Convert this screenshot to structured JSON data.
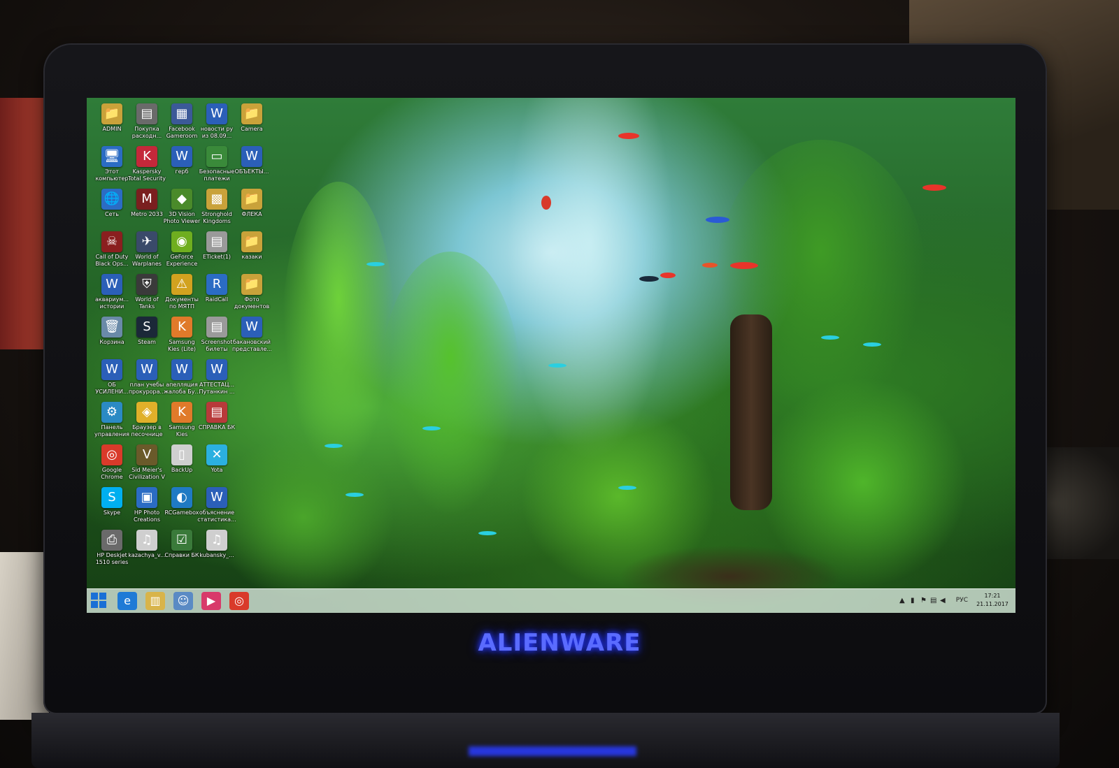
{
  "brand": {
    "logo_text": "ALIENWARE"
  },
  "desktop": {
    "icons": [
      {
        "label": "ADMIN",
        "glyph": "📁",
        "color": "#c9a23a",
        "col": 0,
        "row": 0
      },
      {
        "label": "Покупка расходн...",
        "glyph": "▤",
        "color": "#6a6a6a",
        "col": 1,
        "row": 0
      },
      {
        "label": "Facebook Gameroom",
        "glyph": "▦",
        "color": "#3b5998",
        "col": 2,
        "row": 0
      },
      {
        "label": "новости ру из 08.09...",
        "glyph": "W",
        "color": "#2b5fb8",
        "col": 3,
        "row": 0
      },
      {
        "label": "Camera",
        "glyph": "📁",
        "color": "#c9a23a",
        "col": 4,
        "row": 0
      },
      {
        "label": "Этот компьютер",
        "glyph": "🖥",
        "color": "#2b6cc4",
        "col": 0,
        "row": 1
      },
      {
        "label": "Kaspersky Total Security",
        "glyph": "K",
        "color": "#c4283a",
        "col": 1,
        "row": 1
      },
      {
        "label": "герб",
        "glyph": "W",
        "color": "#2b5fb8",
        "col": 2,
        "row": 1
      },
      {
        "label": "Безопасные платежи",
        "glyph": "▭",
        "color": "#3a8a3a",
        "col": 3,
        "row": 1
      },
      {
        "label": "ОБЪЕКТЫ...",
        "glyph": "W",
        "color": "#2b5fb8",
        "col": 4,
        "row": 1
      },
      {
        "label": "Сеть",
        "glyph": "🌐",
        "color": "#2b6cc4",
        "col": 0,
        "row": 2
      },
      {
        "label": "Metro 2033",
        "glyph": "M",
        "color": "#7a1f1f",
        "col": 1,
        "row": 2
      },
      {
        "label": "3D Vision Photo Viewer",
        "glyph": "◆",
        "color": "#4a8a2a",
        "col": 2,
        "row": 2
      },
      {
        "label": "Stronghold Kingdoms",
        "glyph": "▩",
        "color": "#c9a23a",
        "col": 3,
        "row": 2
      },
      {
        "label": "ФЛЕКА",
        "glyph": "📁",
        "color": "#c9a23a",
        "col": 4,
        "row": 2
      },
      {
        "label": "Call of Duty Black Ops...",
        "glyph": "☠",
        "color": "#8a1f1f",
        "col": 0,
        "row": 3
      },
      {
        "label": "World of Warplanes",
        "glyph": "✈",
        "color": "#3a4a6a",
        "col": 1,
        "row": 3
      },
      {
        "label": "GeForce Experience",
        "glyph": "◉",
        "color": "#6fae1f",
        "col": 2,
        "row": 3
      },
      {
        "label": "ETicket(1)",
        "glyph": "▤",
        "color": "#9a9a9a",
        "col": 3,
        "row": 3
      },
      {
        "label": "казаки",
        "glyph": "📁",
        "color": "#c9a23a",
        "col": 4,
        "row": 3
      },
      {
        "label": "аквариум... истории",
        "glyph": "W",
        "color": "#2b5fb8",
        "col": 0,
        "row": 4
      },
      {
        "label": "World of Tanks",
        "glyph": "⛨",
        "color": "#3a3a3a",
        "col": 1,
        "row": 4
      },
      {
        "label": "Документы по МЯТП",
        "glyph": "⚠",
        "color": "#d2a21f",
        "col": 2,
        "row": 4
      },
      {
        "label": "RaidCall",
        "glyph": "R",
        "color": "#2b6cc4",
        "col": 3,
        "row": 4
      },
      {
        "label": "Фото документов",
        "glyph": "📁",
        "color": "#c9a23a",
        "col": 4,
        "row": 4
      },
      {
        "label": "Корзина",
        "glyph": "🗑",
        "color": "#6a8aa8",
        "col": 0,
        "row": 5
      },
      {
        "label": "Steam",
        "glyph": "S",
        "color": "#1b2838",
        "col": 1,
        "row": 5
      },
      {
        "label": "Samsung Kies (Lite)",
        "glyph": "K",
        "color": "#e07a2a",
        "col": 2,
        "row": 5
      },
      {
        "label": "Screenshot билеты",
        "glyph": "▤",
        "color": "#9a9a9a",
        "col": 3,
        "row": 5
      },
      {
        "label": "бакановский представле...",
        "glyph": "W",
        "color": "#2b5fb8",
        "col": 4,
        "row": 5
      },
      {
        "label": "ОБ УСИЛЕНИ...",
        "glyph": "W",
        "color": "#2b5fb8",
        "col": 0,
        "row": 6
      },
      {
        "label": "план учебы прокурора...",
        "glyph": "W",
        "color": "#2b5fb8",
        "col": 1,
        "row": 6
      },
      {
        "label": "апелляция жалоба Бу...",
        "glyph": "W",
        "color": "#2b5fb8",
        "col": 2,
        "row": 6
      },
      {
        "label": "АТТЕСТАЦ... Путанкин ...",
        "glyph": "W",
        "color": "#2b5fb8",
        "col": 3,
        "row": 6
      },
      {
        "label": "Панель управления",
        "glyph": "⚙",
        "color": "#2b8ac4",
        "col": 0,
        "row": 7
      },
      {
        "label": "Браузер в песочнице",
        "glyph": "◈",
        "color": "#e0b02a",
        "col": 1,
        "row": 7
      },
      {
        "label": "Samsung Kies",
        "glyph": "K",
        "color": "#e07a2a",
        "col": 2,
        "row": 7
      },
      {
        "label": "СПРАВКА БК",
        "glyph": "▤",
        "color": "#b83a3a",
        "col": 3,
        "row": 7
      },
      {
        "label": "Google Chrome",
        "glyph": "◎",
        "color": "#d93a2a",
        "col": 0,
        "row": 8
      },
      {
        "label": "Sid Meier's Civilization V",
        "glyph": "V",
        "color": "#6a5a2a",
        "col": 1,
        "row": 8
      },
      {
        "label": "BackUp",
        "glyph": "▯",
        "color": "#cfcfcf",
        "col": 2,
        "row": 8
      },
      {
        "label": "Yota",
        "glyph": "✕",
        "color": "#2bb0e0",
        "col": 3,
        "row": 8
      },
      {
        "label": "Skype",
        "glyph": "S",
        "color": "#00aff0",
        "col": 0,
        "row": 9
      },
      {
        "label": "HP Photo Creations",
        "glyph": "▣",
        "color": "#2b6cc4",
        "col": 1,
        "row": 9
      },
      {
        "label": "RCGamebox",
        "glyph": "◐",
        "color": "#1f7ac4",
        "col": 2,
        "row": 9
      },
      {
        "label": "объяснение статистика...",
        "glyph": "W",
        "color": "#2b5fb8",
        "col": 3,
        "row": 9
      },
      {
        "label": "HP Deskjet 1510 series",
        "glyph": "⎙",
        "color": "#6a6a6a",
        "col": 0,
        "row": 10
      },
      {
        "label": "kazachya_v...",
        "glyph": "♫",
        "color": "#cfcfcf",
        "col": 1,
        "row": 10
      },
      {
        "label": "Справки БК",
        "glyph": "☑",
        "color": "#3a7a3a",
        "col": 2,
        "row": 10
      },
      {
        "label": "kubansky_...",
        "glyph": "♫",
        "color": "#cfcfcf",
        "col": 3,
        "row": 10
      }
    ]
  },
  "taskbar": {
    "pinned": [
      {
        "name": "ie-icon",
        "glyph": "e",
        "color": "#1f7ad6"
      },
      {
        "name": "file-explorer-icon",
        "glyph": "▥",
        "color": "#d8b44a"
      },
      {
        "name": "people-icon",
        "glyph": "☺",
        "color": "#5a8ac4"
      },
      {
        "name": "media-player-icon",
        "glyph": "▶",
        "color": "#d83a6a"
      },
      {
        "name": "chrome-icon",
        "glyph": "◎",
        "color": "#d93a2a"
      }
    ],
    "tray": {
      "overflow_glyph": "▲",
      "language": "РУС",
      "time": "17:21",
      "date": "21.11.2017"
    }
  }
}
